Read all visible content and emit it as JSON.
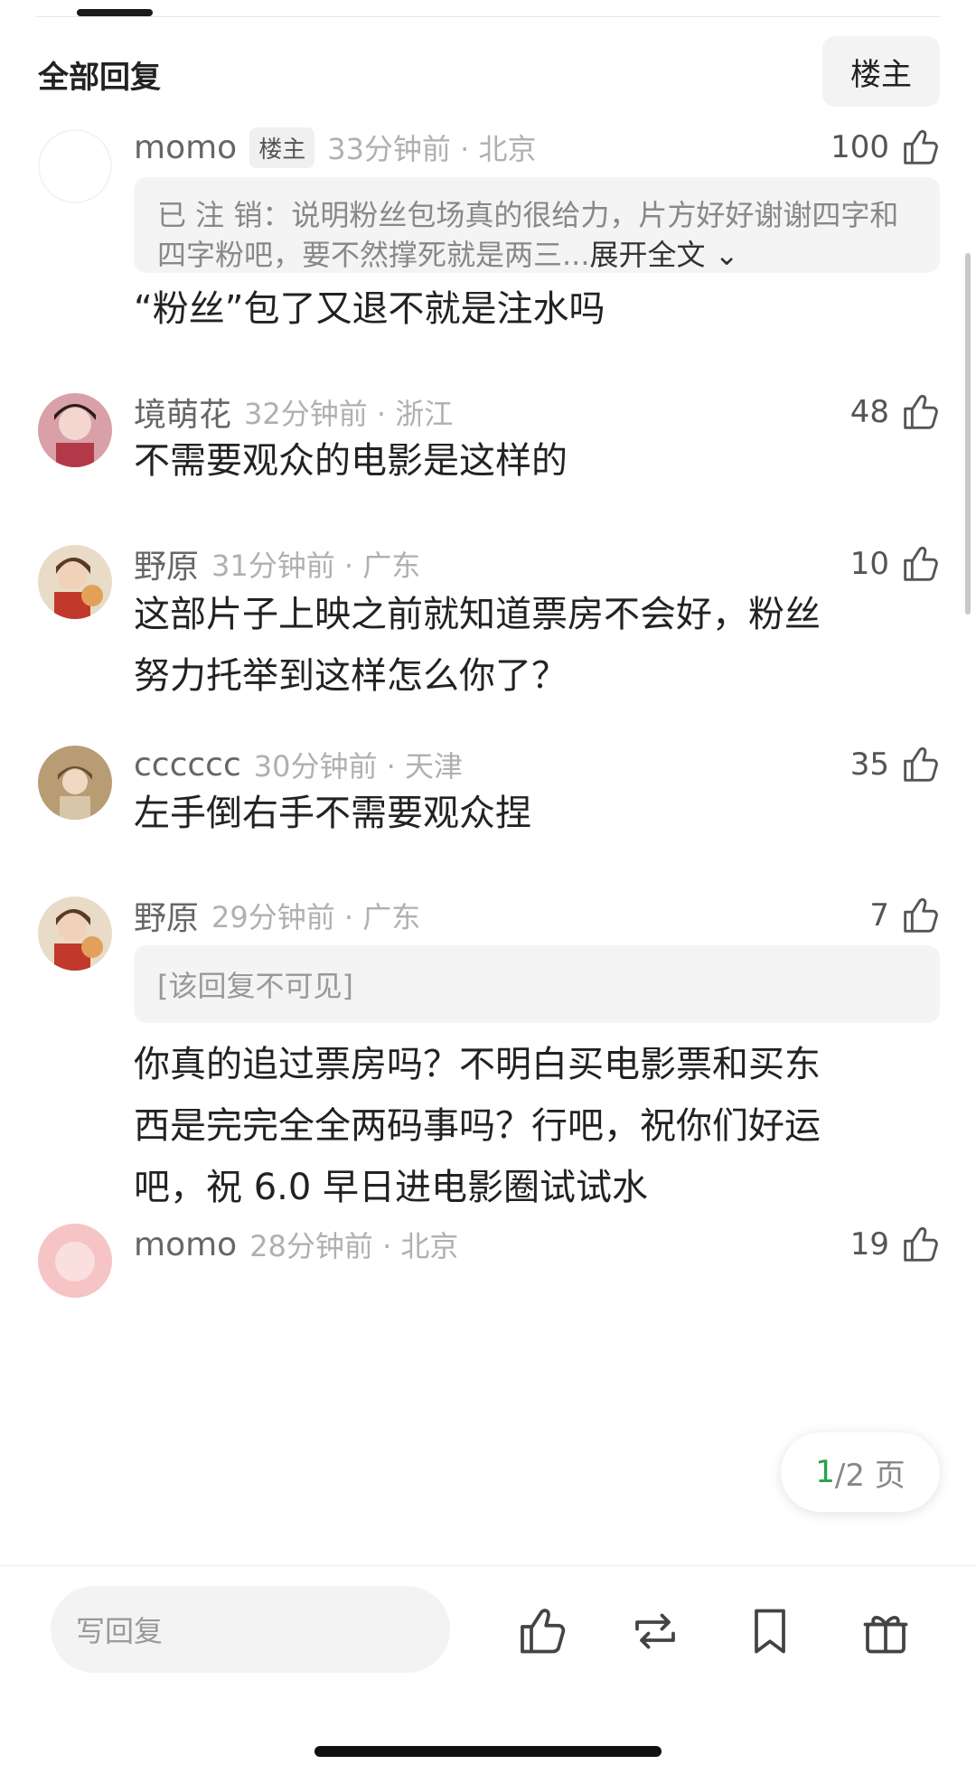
{
  "header": {
    "title": "全部回复",
    "filter_label": "楼主"
  },
  "comments": [
    {
      "username": "momo",
      "tag": "楼主",
      "time": "33分钟前 · 北京",
      "likes": "100",
      "quote": {
        "text": "已 注 销：说明粉丝包场真的很给力，片方好好谢谢四字和四字粉吧，要不然撑死就是两三...",
        "expand": "展开全文"
      },
      "body": "“粉丝”包了又退不就是注水吗"
    },
    {
      "username": "境萌花",
      "time": "32分钟前 · 浙江",
      "likes": "48",
      "body": "不需要观众的电影是这样的"
    },
    {
      "username": "野原",
      "time": "31分钟前 · 广东",
      "likes": "10",
      "body_lines": [
        "这部片子上映之前就知道票房不会好，粉丝",
        "努力托举到这样怎么你了？"
      ]
    },
    {
      "username": "cccccc",
      "time": "30分钟前 · 天津",
      "likes": "35",
      "body": "左手倒右手不需要观众捏"
    },
    {
      "username": "野原",
      "time": "29分钟前 · 广东",
      "likes": "7",
      "hidden_quote": "[该回复不可见]",
      "body_lines": [
        "你真的追过票房吗？不明白买电影票和买东",
        "西是完完全全两码事吗？行吧，祝你们好运",
        "吧，祝 6.0 早日进电影圈试试水"
      ]
    },
    {
      "username": "momo",
      "time": "28分钟前 · 北京",
      "likes": "19"
    }
  ],
  "pager": {
    "current": "1",
    "rest": "/2 页"
  },
  "bottom_bar": {
    "reply_placeholder": "写回复",
    "icons": [
      "thumbs-up-icon",
      "repost-icon",
      "bookmark-icon",
      "gift-icon"
    ]
  },
  "colors": {
    "accent_green": "#2aa147",
    "meta_gray": "#b0b0b0",
    "quote_bg": "#f4f4f4"
  }
}
